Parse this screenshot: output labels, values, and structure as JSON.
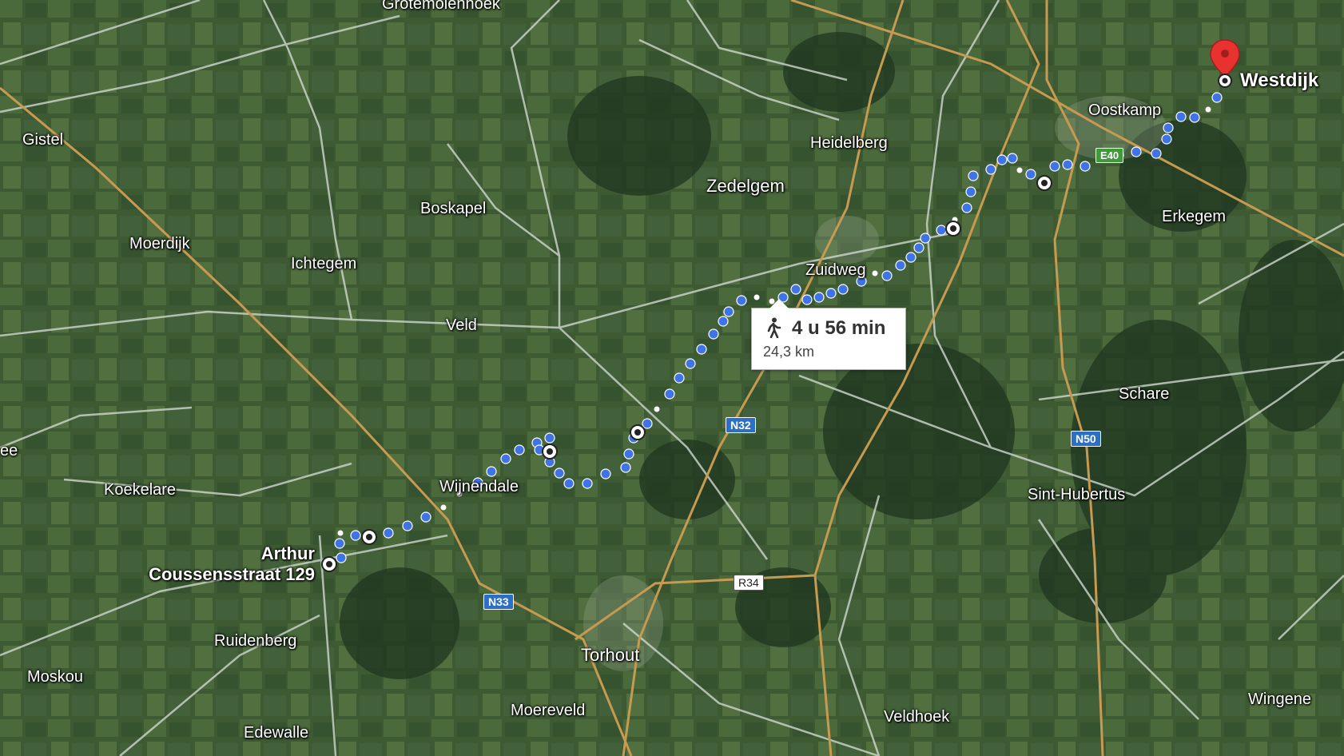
{
  "colors": {
    "route": "#3f73e6",
    "route_outline": "#ffffff",
    "major_road": "#c79a52",
    "minor_road": "#cfd8cf",
    "destination_pin": "#e8322f"
  },
  "places": {
    "gistel": "Gistel",
    "grotemolenhoek": "Grotemolenhoek",
    "boskapel": "Boskapel",
    "moerdijk": "Moerdijk",
    "ichtegem": "Ichtegem",
    "veld": "Veld",
    "heidelberg": "Heidelberg",
    "zedelgem": "Zedelgem",
    "zuidweg": "Zuidweg",
    "oostkamp": "Oostkamp",
    "erkegem": "Erkegem",
    "schare": "Schare",
    "sint_hubertus": "Sint-Hubertus",
    "koekelare": "Koekelare",
    "wijnendale": "Wijnendale",
    "ruidenberg": "Ruidenberg",
    "moskou": "Moskou",
    "torhout": "Torhout",
    "moereveld": "Moereveld",
    "edewalle": "Edewalle",
    "veldhoek": "Veldhoek",
    "wingene": "Wingene",
    "ee": "ee"
  },
  "endpoints": {
    "start_line1": "Arthur",
    "start_line2": "Coussensstraat 129",
    "destination": "Westdijk"
  },
  "road_shields": {
    "n32": "N32",
    "n33": "N33",
    "n50": "N50",
    "e40": "E40",
    "r34": "R34"
  },
  "route_info": {
    "mode_icon": "walking-person-icon",
    "duration": "4 u 56 min",
    "distance": "24,3 km"
  }
}
